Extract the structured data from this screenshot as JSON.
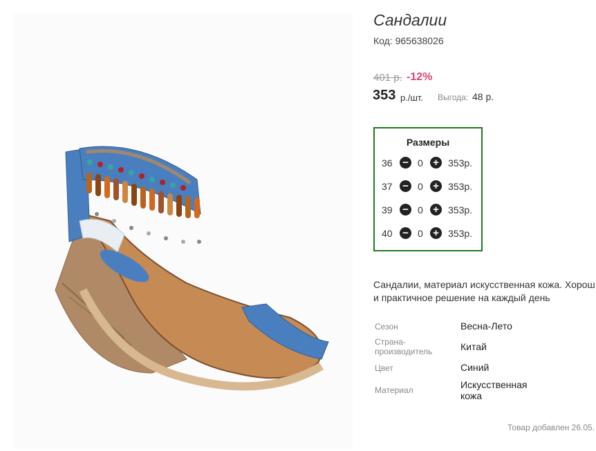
{
  "product": {
    "title": "Сандалии",
    "code_label": "Код: 965638026",
    "old_price": "401 р.",
    "discount": "-12%",
    "price": "353",
    "price_unit": "р./шт.",
    "saving_label": "Выгода:",
    "saving_value": "48 р."
  },
  "sizes": {
    "title": "Размеры",
    "minus_icon": "−",
    "plus_icon": "+",
    "rows": [
      {
        "size": "36",
        "qty": "0",
        "price": "353р."
      },
      {
        "size": "37",
        "qty": "0",
        "price": "353р."
      },
      {
        "size": "39",
        "qty": "0",
        "price": "353р."
      },
      {
        "size": "40",
        "qty": "0",
        "price": "353р."
      }
    ]
  },
  "description": {
    "line1": "Сандалии, материал искусственная кожа. Хорош",
    "line2": "и практичное решение на каждый день"
  },
  "attributes": [
    {
      "label": "Сезон",
      "value": "Весна-Лето"
    },
    {
      "label": "Страна-производитель",
      "value": "Китай"
    },
    {
      "label": "Цвет",
      "value": "Синий"
    },
    {
      "label": "Материал",
      "value": "Искусственная кожа"
    }
  ],
  "added_text": "Товар добавлен 26.05.",
  "colors": {
    "discount": "#e0426d",
    "sizes_border": "#1e7a1e",
    "sandal_strap": "#4a7fbf"
  }
}
